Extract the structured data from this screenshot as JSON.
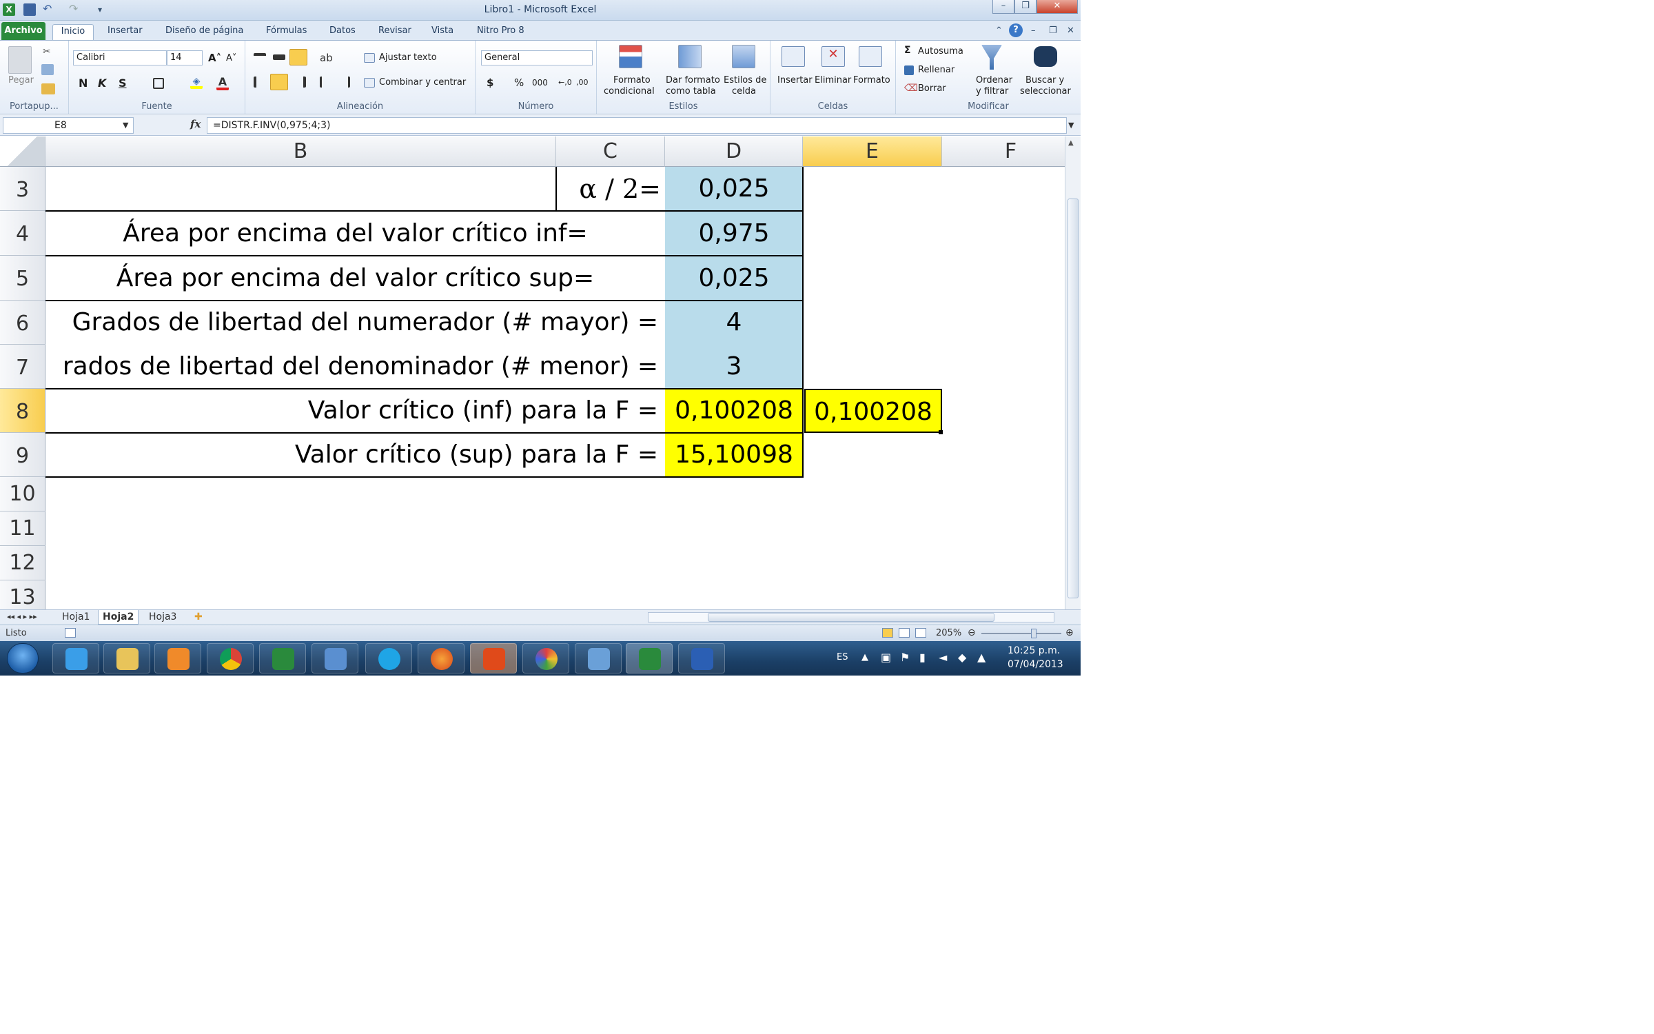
{
  "window": {
    "title": "Libro1  -  Microsoft Excel"
  },
  "tabs": {
    "file": "Archivo",
    "items": [
      "Inicio",
      "Insertar",
      "Diseño de página",
      "Fórmulas",
      "Datos",
      "Revisar",
      "Vista",
      "Nitro Pro 8"
    ],
    "active": "Inicio"
  },
  "ribbon": {
    "clipboard": {
      "paste": "Pegar",
      "label": "Portapup..."
    },
    "font": {
      "name": "Calibri",
      "size": "14",
      "bold": "N",
      "italic": "K",
      "underline": "S",
      "label": "Fuente"
    },
    "alignment": {
      "wrap": "Ajustar texto",
      "merge": "Combinar y centrar",
      "label": "Alineación"
    },
    "number": {
      "format": "General",
      "currency": "$",
      "percent": "%",
      "thousands": "000",
      "inc": "←,0",
      "dec": ",00",
      "label": "Número"
    },
    "styles": {
      "conditional_1": "Formato",
      "conditional_2": "condicional",
      "table_1": "Dar formato",
      "table_2": "como tabla",
      "cell_1": "Estilos de",
      "cell_2": "celda",
      "label": "Estilos"
    },
    "cells": {
      "insert": "Insertar",
      "delete": "Eliminar",
      "format": "Formato",
      "label": "Celdas"
    },
    "editing": {
      "autosum": "Autosuma",
      "fill": "Rellenar",
      "clear": "Borrar",
      "sort_1": "Ordenar",
      "sort_2": "y filtrar",
      "find_1": "Buscar y",
      "find_2": "seleccionar",
      "label": "Modificar"
    }
  },
  "formula_bar": {
    "name_box": "E8",
    "fx": "fx",
    "formula": "=DISTR.F.INV(0,975;4;3)"
  },
  "columns": [
    "B",
    "C",
    "D",
    "E",
    "F"
  ],
  "selected_column": "E",
  "rows": [
    "3",
    "4",
    "5",
    "6",
    "7",
    "8",
    "9",
    "10",
    "11",
    "12",
    "13"
  ],
  "selected_row": "8",
  "cells": {
    "C3": "α / 2=",
    "D3": "0,025",
    "B4": "Área por encima del valor crítico inf=",
    "D4": "0,975",
    "B5": "Área por encima del valor crítico sup=",
    "D5": "0,025",
    "B6": "Grados de libertad del numerador (# mayor) =",
    "D6": "4",
    "B7": "rados de libertad del denominador (# menor) =",
    "D7": "3",
    "B8": "Valor crítico (inf) para la F =",
    "D8": "0,100208",
    "E8": "0,100208",
    "B9": "Valor crítico (sup) para la F =",
    "D9": "15,10098"
  },
  "sheets": [
    "Hoja1",
    "Hoja2",
    "Hoja3"
  ],
  "active_sheet": "Hoja2",
  "status": {
    "ready": "Listo",
    "zoom": "205%"
  },
  "taskbar": {
    "lang": "ES",
    "time": "10:25 p.m.",
    "date": "07/04/2013"
  },
  "colors": {
    "excel_green": "#2a8a3c",
    "input_blue": "#b9dceb",
    "result_yellow": "#ffff00",
    "selection_header": "#f8cd4f"
  }
}
